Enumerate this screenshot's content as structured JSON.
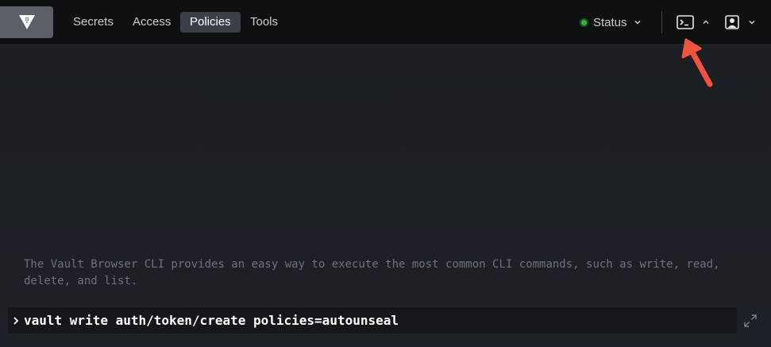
{
  "nav": {
    "links": [
      {
        "label": "Secrets",
        "active": false
      },
      {
        "label": "Access",
        "active": false
      },
      {
        "label": "Policies",
        "active": true
      },
      {
        "label": "Tools",
        "active": false
      }
    ],
    "status_label": "Status",
    "status_color": "#2eb039",
    "icons": {
      "logo": "vault-logo-icon",
      "status_chevron": "chevron-down-icon",
      "console": "terminal-icon",
      "console_chevron": "chevron-up-icon",
      "user": "user-icon",
      "user_chevron": "chevron-down-icon"
    }
  },
  "annotation": {
    "arrow_color": "#f0533f",
    "points_to": "terminal-icon"
  },
  "console": {
    "help_text": "The Vault Browser CLI provides an easy way to execute the most common CLI commands, such as write, read, delete, and list.",
    "input_value": "vault write auth/token/create policies=autounseal",
    "prompt_icon": "chevron-right-icon",
    "expand_icon": "expand-icon"
  }
}
